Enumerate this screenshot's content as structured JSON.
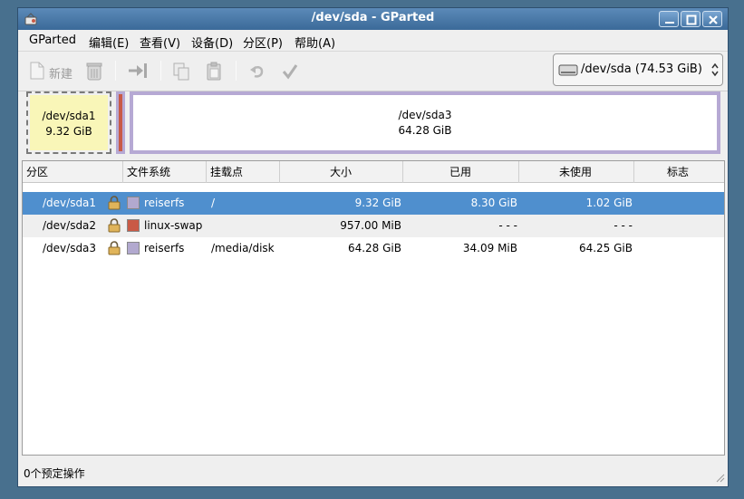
{
  "window": {
    "title": "/dev/sda - GParted"
  },
  "menu": {
    "items": [
      {
        "label": "GParted"
      },
      {
        "label": "编辑(E)"
      },
      {
        "label": "查看(V)"
      },
      {
        "label": "设备(D)"
      },
      {
        "label": "分区(P)"
      },
      {
        "label": "帮助(A)"
      }
    ]
  },
  "toolbar": {
    "new_label": "新建",
    "icons": [
      "new-icon",
      "delete-icon",
      "resize-move-icon",
      "copy-icon",
      "paste-icon",
      "undo-icon",
      "apply-icon"
    ]
  },
  "device_selector": {
    "value": "/dev/sda  (74.53 GiB)"
  },
  "diskmap": {
    "partitions": [
      {
        "name": "/dev/sda1",
        "size": "9.32 GiB"
      },
      {
        "name": "/dev/sda2",
        "size": ""
      },
      {
        "name": "/dev/sda3",
        "size": "64.28 GiB"
      }
    ]
  },
  "table": {
    "columns": [
      "分区",
      "文件系统",
      "挂载点",
      "大小",
      "已用",
      "未使用",
      "标志"
    ],
    "rows": [
      {
        "partition": "/dev/sda1",
        "filesystem": "reiserfs",
        "fs_color": "#b2a9cf",
        "mount": "/",
        "size": "9.32 GiB",
        "used": "8.30 GiB",
        "unused": "1.02 GiB",
        "flags": "",
        "locked": true
      },
      {
        "partition": "/dev/sda2",
        "filesystem": "linux-swap",
        "fs_color": "#c95a46",
        "mount": "",
        "size": "957.00 MiB",
        "used": "- - -",
        "unused": "- - -",
        "flags": "",
        "locked": true
      },
      {
        "partition": "/dev/sda3",
        "filesystem": "reiserfs",
        "fs_color": "#b2a9cf",
        "mount": "/media/disk",
        "size": "64.28 GiB",
        "used": "34.09 MiB",
        "unused": "64.25 GiB",
        "flags": "",
        "locked": true
      }
    ],
    "selected_row": 0
  },
  "status": {
    "text": "0个预定操作"
  },
  "colors": {
    "selection": "#4f8fce",
    "titlebar": "#3b6a99",
    "swap": "#c95a46",
    "reiserfs": "#b2a9cf",
    "sda1_fill": "#f9f6b8"
  }
}
